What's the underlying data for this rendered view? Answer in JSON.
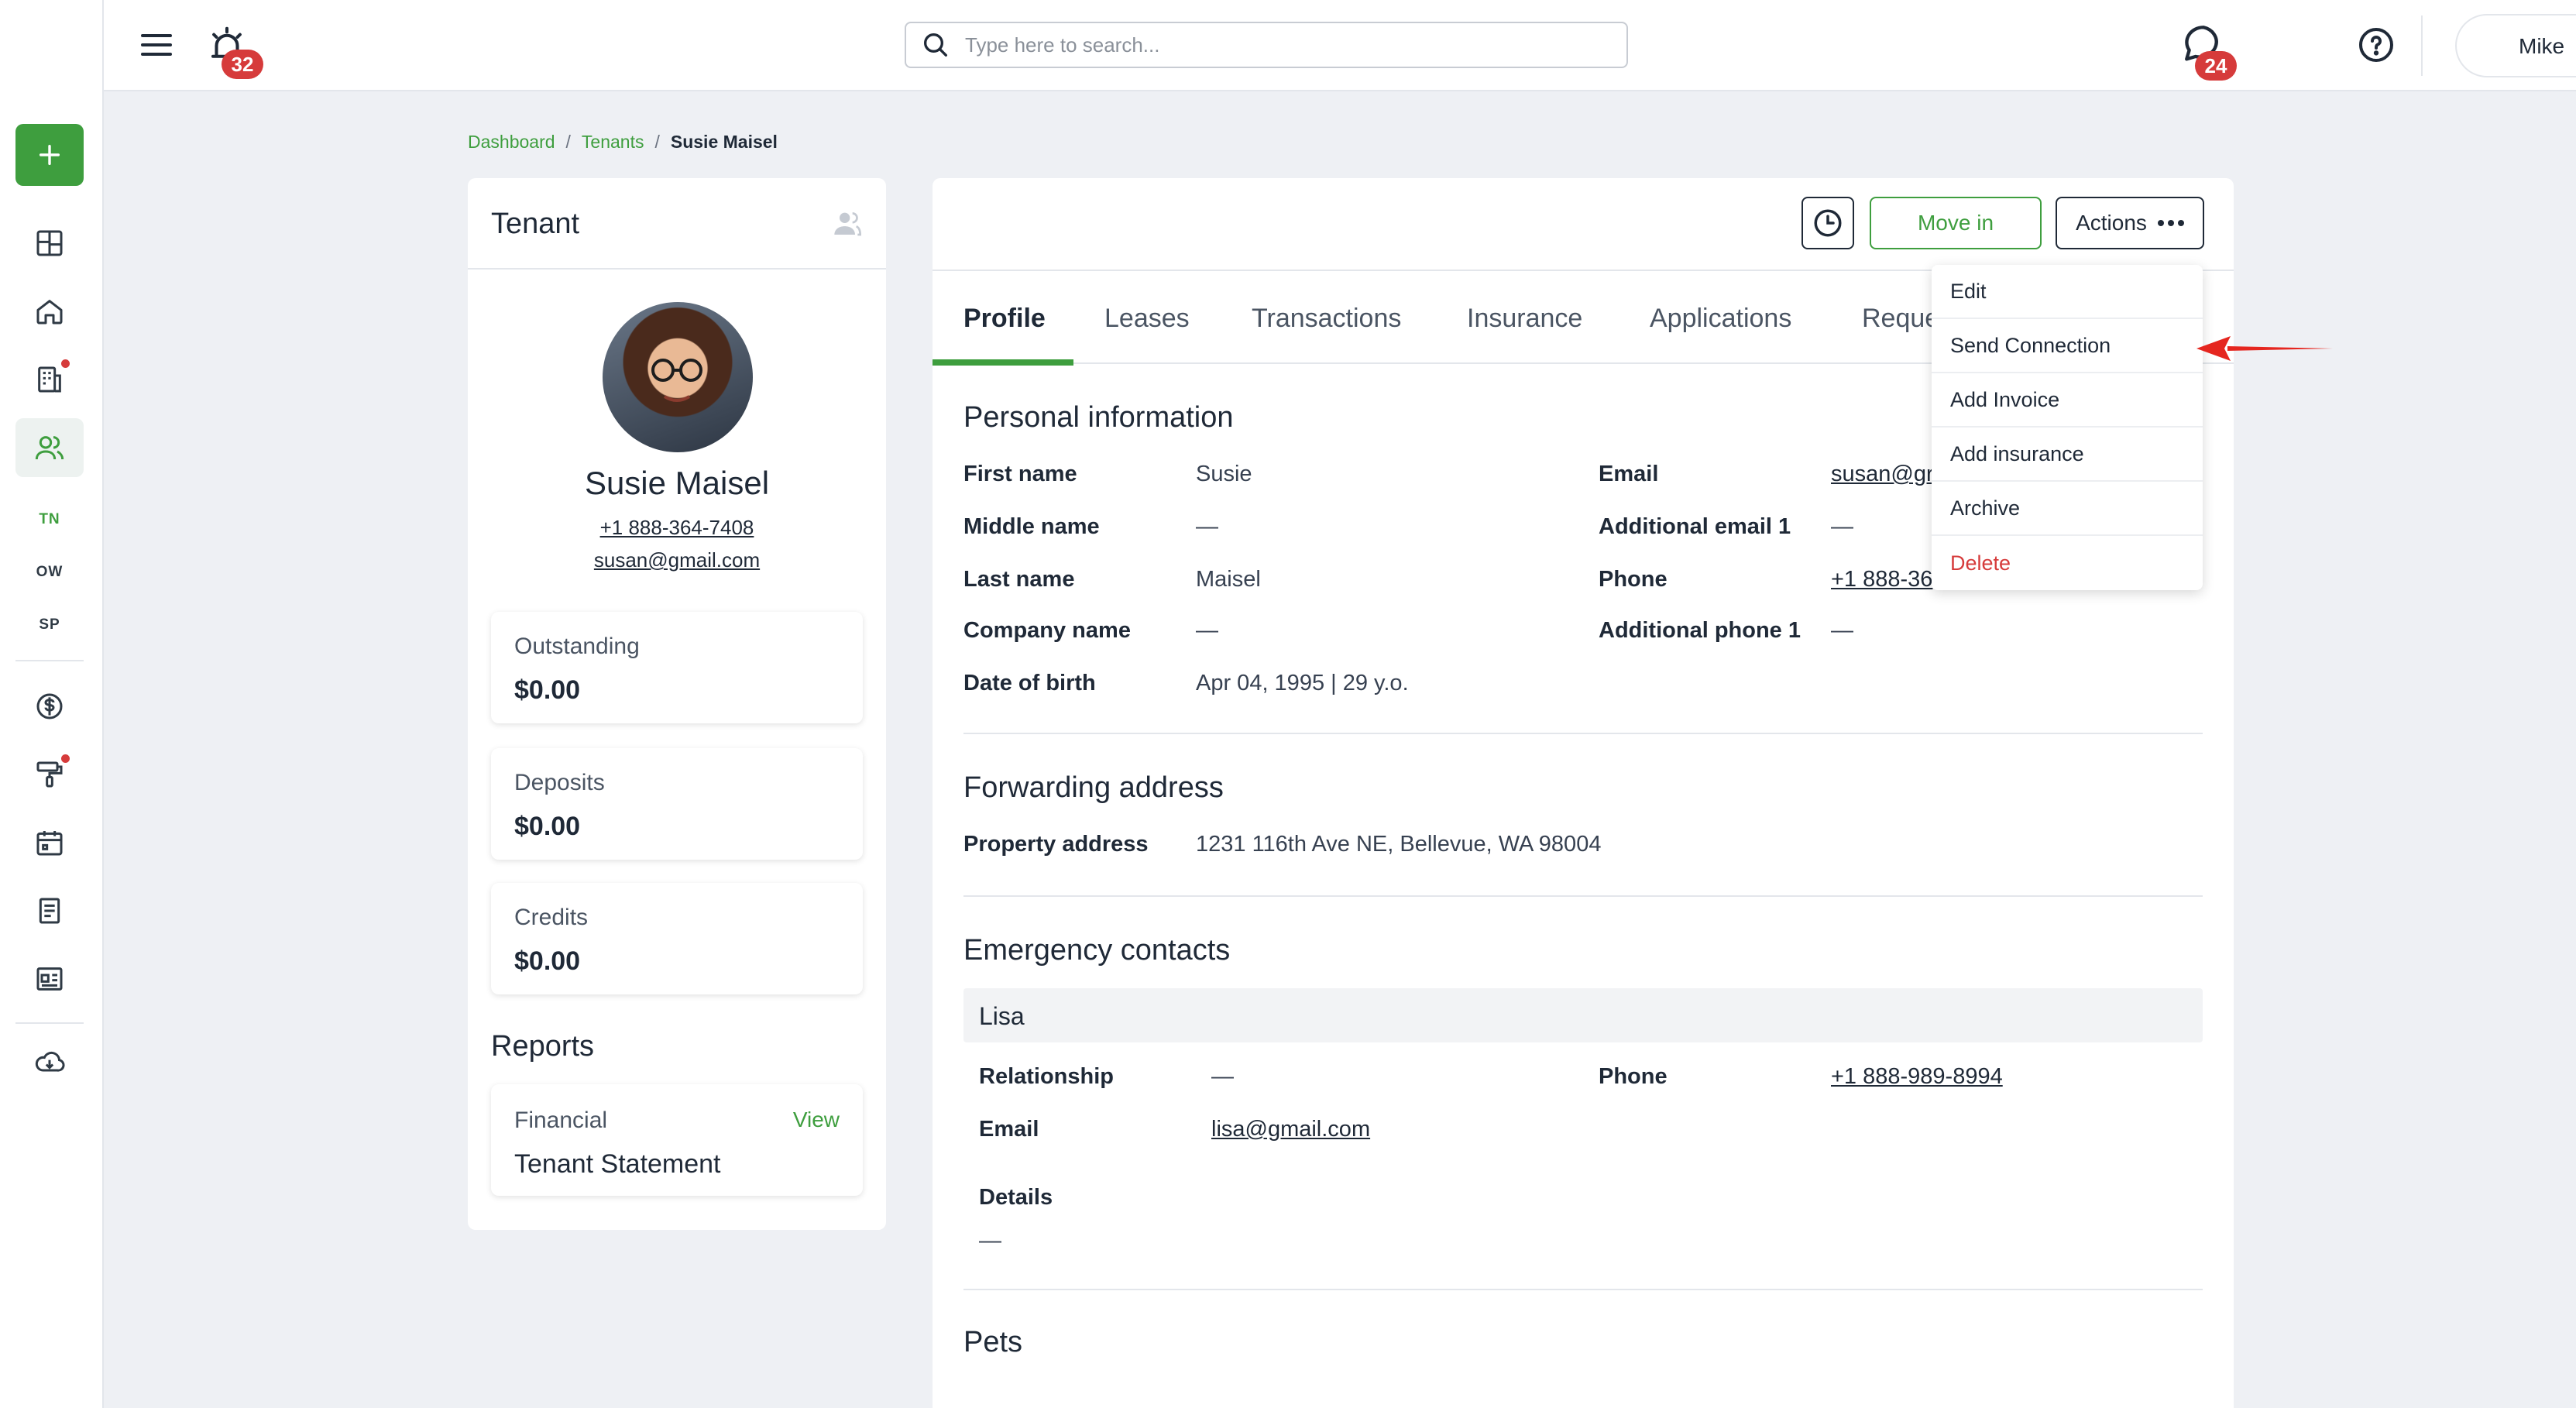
{
  "topbar": {
    "alarm_badge": "32",
    "search_placeholder": "Type here to search...",
    "chat_badge": "24",
    "user_name": "Mike"
  },
  "rail": {
    "abbreviations": [
      "TN",
      "OW",
      "SP"
    ]
  },
  "breadcrumb": {
    "dashboard": "Dashboard",
    "tenants": "Tenants",
    "current": "Susie Maisel",
    "separator": "/"
  },
  "tenant_card": {
    "title": "Tenant",
    "name": "Susie Maisel",
    "phone": "+1 888-364-7408",
    "email": "susan@gmail.com",
    "stats": [
      {
        "label": "Outstanding",
        "value": "$0.00"
      },
      {
        "label": "Deposits",
        "value": "$0.00"
      },
      {
        "label": "Credits",
        "value": "$0.00"
      }
    ],
    "reports_title": "Reports",
    "report": {
      "category": "Financial",
      "view_label": "View",
      "name": "Tenant Statement"
    }
  },
  "main": {
    "move_in_label": "Move in",
    "actions_label": "Actions",
    "tabs": [
      "Profile",
      "Leases",
      "Transactions",
      "Insurance",
      "Applications",
      "Reque"
    ],
    "personal": {
      "title": "Personal information",
      "first_name_label": "First name",
      "first_name": "Susie",
      "middle_name_label": "Middle name",
      "middle_name": "—",
      "last_name_label": "Last name",
      "last_name": "Maisel",
      "company_label": "Company name",
      "company": "—",
      "dob_label": "Date of birth",
      "dob": "Apr 04, 1995 | 29 y.o.",
      "email_label": "Email",
      "email": "susan@gr",
      "add_email_label": "Additional email 1",
      "add_email": "—",
      "phone_label": "Phone",
      "phone": "+1 888-36",
      "add_phone_label": "Additional phone 1",
      "add_phone": "—"
    },
    "forwarding": {
      "title": "Forwarding address",
      "address_label": "Property address",
      "address": "1231 116th Ave NE, Bellevue, WA 98004"
    },
    "emergency": {
      "title": "Emergency contacts",
      "contact_name": "Lisa",
      "relationship_label": "Relationship",
      "relationship": "—",
      "phone_label": "Phone",
      "phone": "+1 888-989-8994",
      "email_label": "Email",
      "email": "lisa@gmail.com",
      "details_label": "Details",
      "details": "—"
    },
    "pets_title": "Pets"
  },
  "dropdown": {
    "items": [
      "Edit",
      "Send Connection",
      "Add Invoice",
      "Add insurance",
      "Archive",
      "Delete"
    ]
  },
  "colors": {
    "accent": "#3e9e3e",
    "danger": "#d63b3b",
    "annotation_arrow": "#e5261f"
  }
}
